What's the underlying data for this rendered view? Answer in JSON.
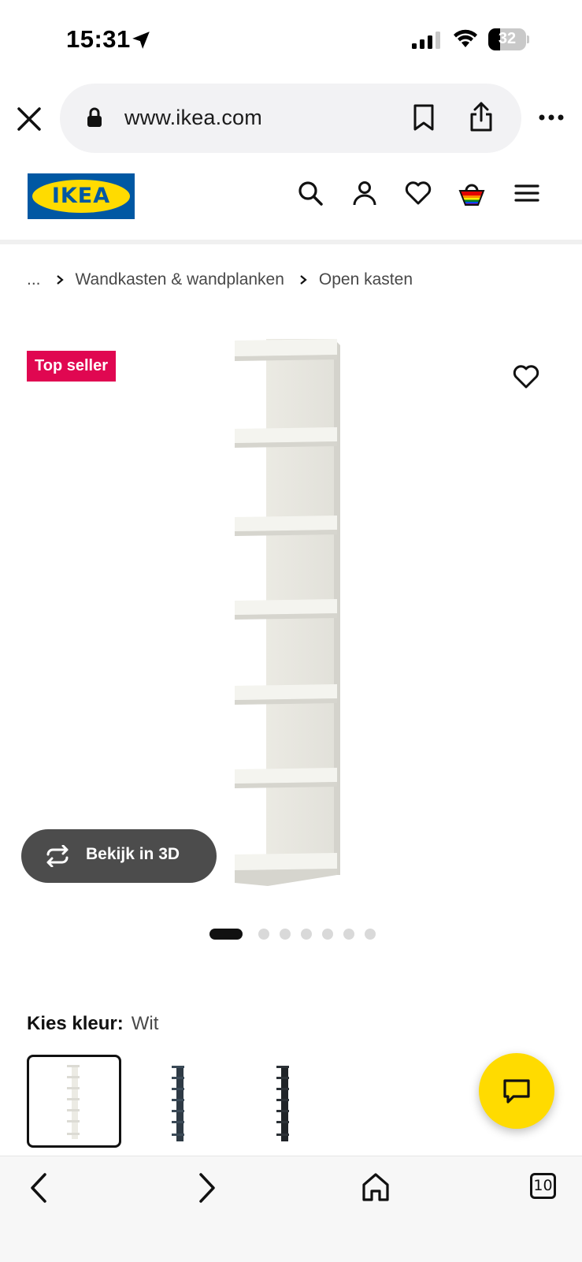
{
  "status_bar": {
    "time": "15:31",
    "battery_level": "32",
    "battery_fraction": 0.32,
    "icons": [
      "location-arrow-icon",
      "signal-icon",
      "wifi-icon",
      "battery-icon"
    ]
  },
  "browser": {
    "url": "www.ikea.com",
    "icons": [
      "close-icon",
      "lock-icon",
      "bookmark-icon",
      "share-icon",
      "more-icon"
    ]
  },
  "header": {
    "logo_text": "IKEA",
    "icons": [
      "search-icon",
      "account-icon",
      "heart-icon",
      "basket-icon",
      "menu-icon"
    ]
  },
  "breadcrumb": {
    "ellipsis": "...",
    "items": [
      "Wandkasten & wandplanken",
      "Open kasten"
    ]
  },
  "gallery": {
    "badge": "Top seller",
    "view_3d_label": "Bekijk in 3D",
    "slide_count": 7,
    "active_slide": 0
  },
  "color_selector": {
    "label": "Kies kleur:",
    "selected_value": "Wit",
    "swatches": [
      {
        "name": "white",
        "color": "#ecebe4",
        "selected": true
      },
      {
        "name": "blue",
        "color": "#2e3a45",
        "selected": false
      },
      {
        "name": "black",
        "color": "#202428",
        "selected": false
      }
    ]
  },
  "toolbar": {
    "tabs_count": "10",
    "icons": [
      "back-icon",
      "forward-icon",
      "home-icon",
      "tabs-icon"
    ]
  },
  "colors": {
    "ikea_blue": "#0058a3",
    "ikea_yellow": "#ffdb00",
    "badge_red": "#e00751"
  }
}
